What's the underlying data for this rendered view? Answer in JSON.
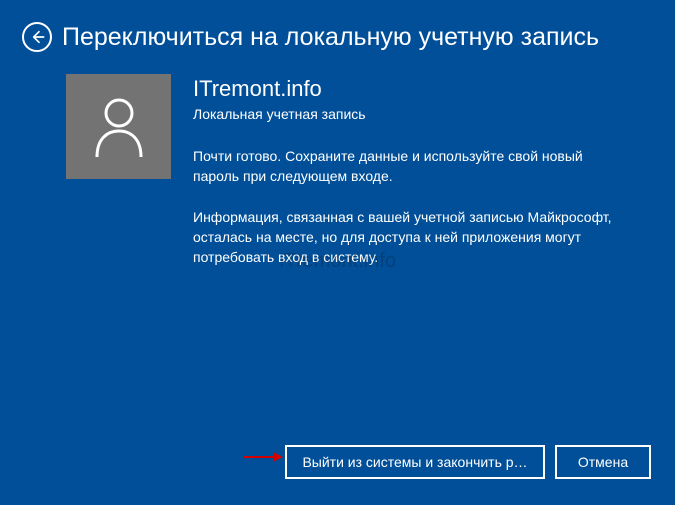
{
  "header": {
    "title": "Переключиться на локальную учетную запись"
  },
  "account": {
    "name": "ITremont.info",
    "type": "Локальная учетная запись"
  },
  "body": {
    "paragraph1": "Почти готово. Сохраните данные и используйте свой новый пароль при следующем входе.",
    "paragraph2": "Информация, связанная с вашей учетной записью Майкрософт, осталась на месте, но для доступа к ней приложения могут потребовать вход в систему."
  },
  "buttons": {
    "signout": "Выйти из системы и закончить р…",
    "cancel": "Отмена"
  },
  "watermark": "ITremont.info"
}
